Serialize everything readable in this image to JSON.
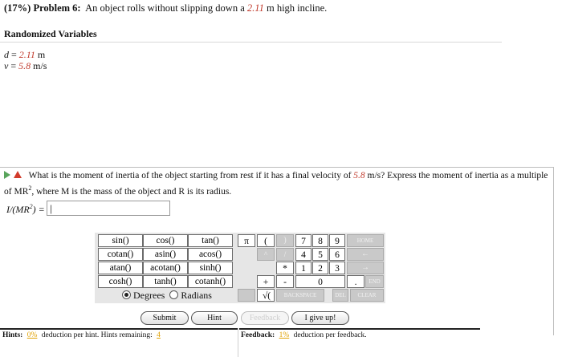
{
  "problem": {
    "prefix": "(17%)",
    "number": "Problem 6:",
    "text_before": "An object rolls without slipping down a",
    "height_value": "2.11",
    "text_after": "m high incline."
  },
  "variables": {
    "title": "Randomized Variables",
    "items": [
      {
        "name": "d",
        "eq": " = ",
        "value": "2.11",
        "unit": " m"
      },
      {
        "name": "v",
        "eq": " = ",
        "value": "5.8",
        "unit": " m/s"
      }
    ]
  },
  "question": {
    "text1": "What is the moment of inertia of the object starting from rest if it has a final velocity of",
    "velocity": "5.8",
    "text2": "m/s? Express the moment of inertia as a multiple of",
    "mr": "MR",
    "sup": "2",
    "text3": ", where M is the mass of the object and R is its radius."
  },
  "answer": {
    "label_pre": "I/(MR",
    "label_sup": "2",
    "label_post": ") =",
    "value": "",
    "placeholder": "|"
  },
  "calculator": {
    "functions": [
      [
        "sin()",
        "cos()",
        "tan()"
      ],
      [
        "cotan()",
        "asin()",
        "acos()"
      ],
      [
        "atan()",
        "acotan()",
        "sinh()"
      ],
      [
        "cosh()",
        "tanh()",
        "cotanh()"
      ]
    ],
    "pi": "π",
    "paren_open": "(",
    "paren_close": ")",
    "pow": "^",
    "div": "/",
    "mul": "*",
    "plus": "+",
    "minus": "-",
    "sqrt": "√(",
    "digits": [
      "7",
      "8",
      "9",
      "4",
      "5",
      "6",
      "1",
      "2",
      "3",
      "0",
      "."
    ],
    "home": "HOME",
    "left": "←",
    "right": "→",
    "end": "END",
    "del": "DEL",
    "backspace": "BACKSPACE",
    "clear": "CLEAR",
    "degrees": "Degrees",
    "radians": "Radians",
    "angle_mode": "Degrees"
  },
  "actions": {
    "submit": "Submit",
    "hint": "Hint",
    "feedback": "Feedback",
    "give_up": "I give up!"
  },
  "hints": {
    "label": "Hints:",
    "pct": "0%",
    "text": "deduction per hint. Hints remaining:",
    "remaining": "4"
  },
  "feedback": {
    "label": "Feedback:",
    "pct": "1%",
    "text": "deduction per feedback."
  },
  "colors": {
    "value_red": "#c0392b",
    "underline_gold": "#e0a000",
    "play_green": "#58a45b",
    "warn_red": "#d23b2b"
  }
}
